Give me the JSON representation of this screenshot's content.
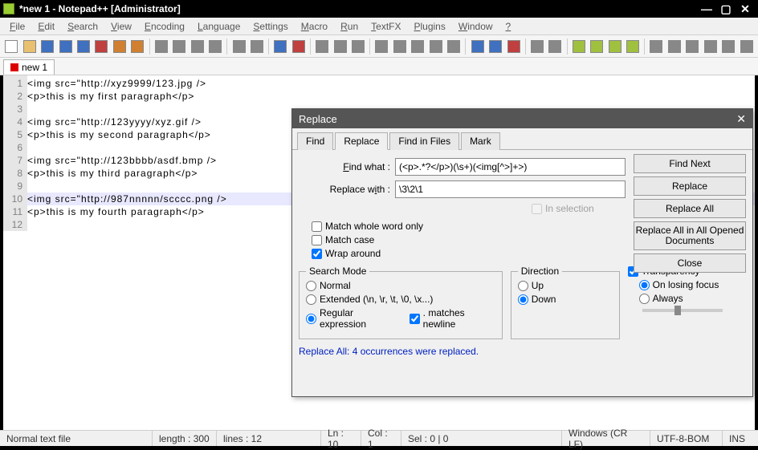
{
  "title": "*new 1 - Notepad++  [Administrator]",
  "menu": [
    "File",
    "Edit",
    "Search",
    "View",
    "Encoding",
    "Language",
    "Settings",
    "Macro",
    "Run",
    "TextFX",
    "Plugins",
    "Window",
    "?"
  ],
  "tab": {
    "label": "new 1"
  },
  "code_lines": [
    "<img src=\"http://xyz9999/123.jpg />",
    "<p>this is my first paragraph</p>",
    "",
    "<img src=\"http://123yyyy/xyz.gif />",
    "<p>this is my second paragraph</p>",
    "",
    "<img src=\"http://123bbbb/asdf.bmp />",
    "<p>this is my third paragraph</p>",
    "",
    "<img src=\"http://987nnnnn/scccc.png />",
    "<p>this is my fourth paragraph</p>",
    ""
  ],
  "highlight_line": 10,
  "status": {
    "type": "Normal text file",
    "length": "length : 300",
    "lines": "lines : 12",
    "ln": "Ln : 10",
    "col": "Col : 1",
    "sel": "Sel : 0 | 0",
    "eol": "Windows (CR LF)",
    "enc": "UTF-8-BOM",
    "mode": "INS"
  },
  "dialog": {
    "title": "Replace",
    "tabs": [
      "Find",
      "Replace",
      "Find in Files",
      "Mark"
    ],
    "active_tab": 1,
    "find_label": "Find what :",
    "find_value": "(<p>.*?</p>)(\\s+)(<img[^>]+>)",
    "replace_label": "Replace with :",
    "replace_value": "\\3\\2\\1",
    "in_selection": "In selection",
    "match_whole": "Match whole word only",
    "match_case": "Match case",
    "wrap_around": "Wrap around",
    "search_mode": {
      "legend": "Search Mode",
      "normal": "Normal",
      "extended": "Extended (\\n, \\r, \\t, \\0, \\x...)",
      "regex": "Regular expression",
      "dotnl": ". matches newline"
    },
    "direction": {
      "legend": "Direction",
      "up": "Up",
      "down": "Down"
    },
    "transparency": {
      "label": "Transparency",
      "on_focus": "On losing focus",
      "always": "Always"
    },
    "buttons": {
      "find_next": "Find Next",
      "replace": "Replace",
      "replace_all": "Replace All",
      "replace_open": "Replace All in All Opened Documents",
      "close": "Close"
    },
    "status_msg": "Replace All: 4 occurrences were replaced."
  }
}
